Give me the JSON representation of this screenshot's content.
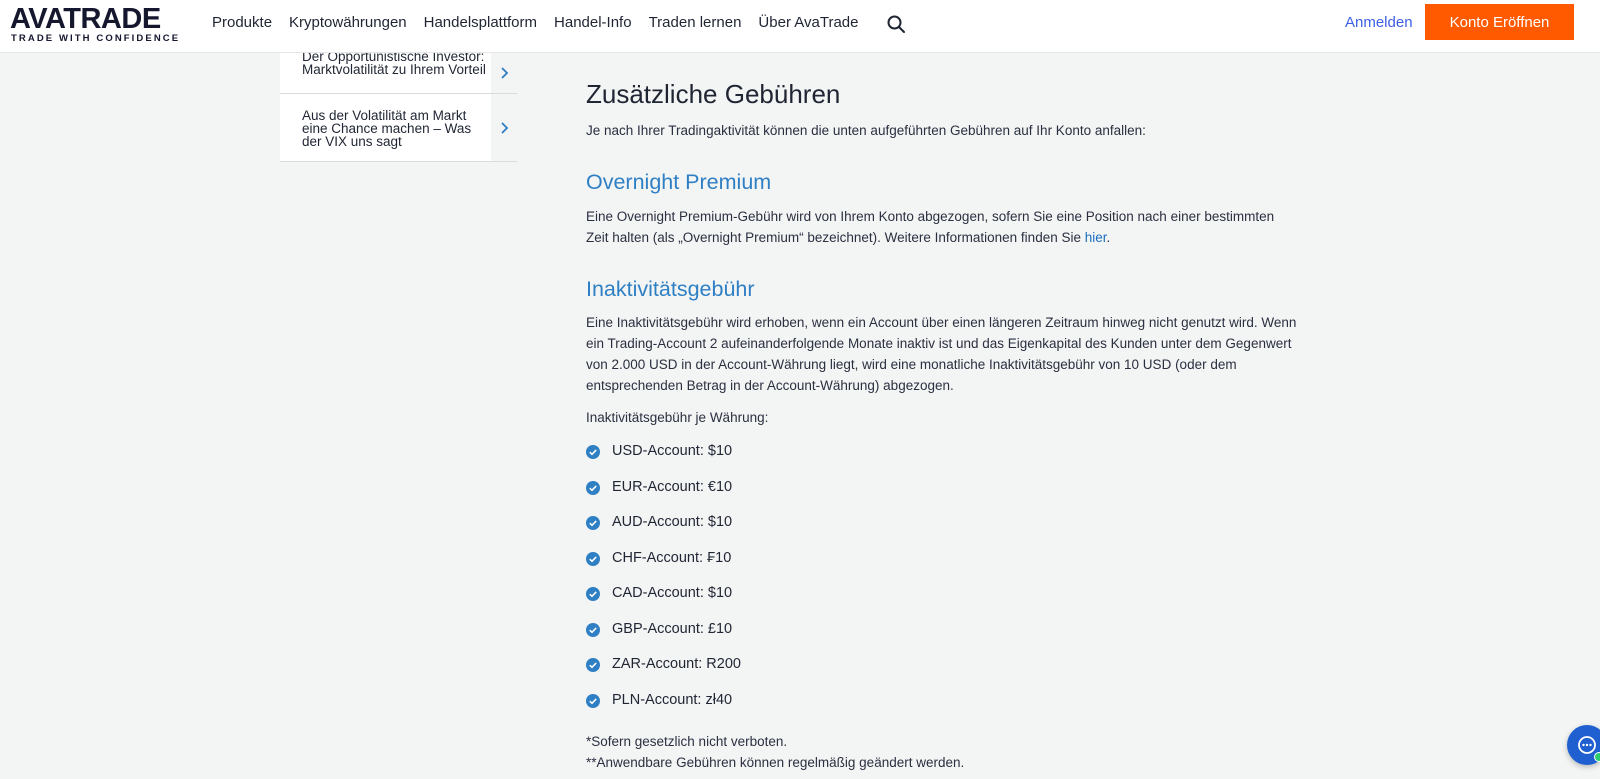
{
  "header": {
    "logo": {
      "word": "AVATRADE",
      "tagline": "TRADE WITH CONFIDENCE"
    },
    "nav": [
      "Produkte",
      "Kryptowährungen",
      "Handelsplattform",
      "Handel-Info",
      "Traden lernen",
      "Über AvaTrade"
    ],
    "search_icon": "search-icon",
    "login_label": "Anmelden",
    "open_account_label": "Konto Eröffnen"
  },
  "sidebar": {
    "items": [
      {
        "label": "Der Opportunistische Investor: Marktvolatilität zu Ihrem Vorteil",
        "icon": "chevron-right-icon"
      },
      {
        "label": "Aus der Volatilität am Markt eine Chance machen – Was der VIX uns sagt",
        "icon": "chevron-right-icon"
      }
    ]
  },
  "main": {
    "title": "Zusätzliche Gebühren",
    "intro": "Je nach Ihrer Tradingaktivität können die unten aufgeführten Gebühren auf Ihr Konto anfallen:",
    "overnight": {
      "heading": "Overnight Premium",
      "text": "Eine Overnight Premium-Gebühr wird von Ihrem Konto abgezogen, sofern Sie eine Position nach einer bestimmten Zeit halten (als „Overnight Premium“ bezeichnet). Weitere Informationen finden Sie ",
      "link": "hier",
      "end": "."
    },
    "inactivity": {
      "heading": "Inaktivitätsgebühr",
      "text": "Eine Inaktivitätsgebühr wird erhoben, wenn ein Account über einen längeren Zeitraum hinweg nicht genutzt wird. Wenn ein Trading-Account 2 aufeinanderfolgende Monate inaktiv ist und das Eigenkapital des Kunden unter dem Gegenwert von 2.000 USD in der Account-Währung liegt, wird eine monatliche Inaktivitätsgebühr von 10 USD (oder dem entsprechenden Betrag in der Account-Währung) abgezogen.",
      "per_currency_label": "Inaktivitätsgebühr je Währung:",
      "fees": [
        "USD-Account: $10",
        "EUR-Account: €10",
        "AUD-Account: $10",
        "CHF-Account: ₣10",
        "CAD-Account: $10",
        "GBP-Account: £10",
        "ZAR-Account: R200",
        "PLN-Account: zł40"
      ],
      "note1": "*Sofern gesetzlich nicht verboten.",
      "note2": "**Anwendbare Gebühren können regelmäßig geändert werden."
    }
  },
  "chat": {
    "icon": "chat-icon"
  },
  "colors": {
    "accent": "#ff5a00",
    "heading_blue": "#2f7fc4",
    "link": "#1a6fc2",
    "login": "#3d5ee6",
    "check": "#2f7fc4"
  }
}
